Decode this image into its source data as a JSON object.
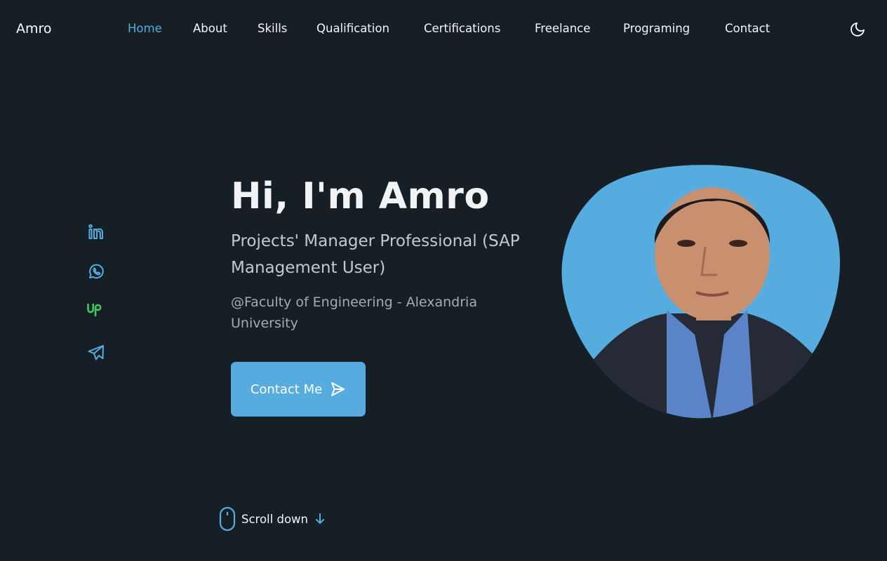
{
  "header": {
    "logo": "Amro",
    "nav": [
      {
        "label": "Home",
        "active": true
      },
      {
        "label": "About",
        "active": false
      },
      {
        "label": "Skills",
        "active": false
      },
      {
        "label": "Qualification",
        "active": false
      },
      {
        "label": "Certifications",
        "active": false
      },
      {
        "label": "Freelance",
        "active": false
      },
      {
        "label": "Programing",
        "active": false
      },
      {
        "label": "Contact",
        "active": false
      }
    ],
    "theme_icon": "moon-icon"
  },
  "socials": [
    {
      "icon": "linkedin-icon"
    },
    {
      "icon": "whatsapp-icon"
    },
    {
      "icon": "upwork-icon"
    },
    {
      "icon": "telegram-icon"
    }
  ],
  "hero": {
    "title": "Hi, I'm Amro",
    "subtitle": "Projects' Manager Professional (SAP Management User)",
    "description": "@Faculty of Engineering - Alexandria University",
    "button_label": "Contact Me",
    "button_icon": "send-icon",
    "scroll_label": "Scroll down"
  },
  "colors": {
    "accent": "#56acdf",
    "background": "#171f26",
    "upwork_green": "#3ec95c"
  }
}
